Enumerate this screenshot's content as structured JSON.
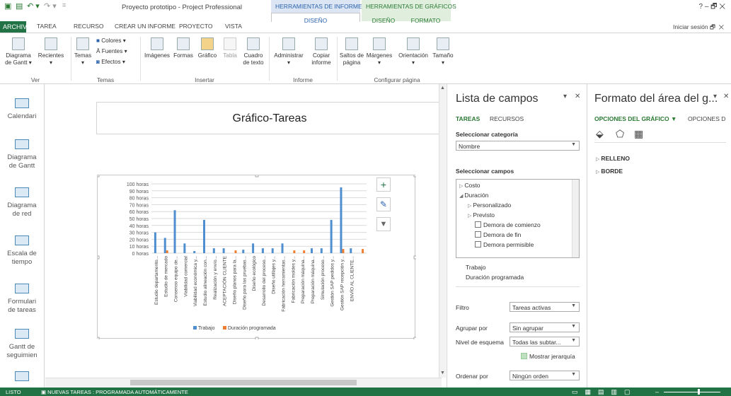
{
  "window": {
    "title": "Proyecto prototipo - Project Professional",
    "controls": "?  –  🗗  ✕"
  },
  "contextual": {
    "reports": {
      "header": "HERRAMIENTAS DE INFORMES",
      "tab": "DISEÑO"
    },
    "charts": {
      "header": "HERRAMIENTAS DE GRÁFICOS",
      "tab1": "DISEÑO",
      "tab2": "FORMATO"
    }
  },
  "tabs": {
    "archivo": "ARCHIVO",
    "tarea": "TAREA",
    "recurso": "RECURSO",
    "crear": "CREAR UN INFORME",
    "proyecto": "PROYECTO",
    "vista": "VISTA"
  },
  "signin": "Iniciar sesión",
  "ribbon": {
    "gantt": "Diagrama\nde Gantt ▾",
    "recientes": "Recientes\n▾",
    "temas": "Temas\n▾",
    "colores": "Colores ▾",
    "fuentes": "Fuentes ▾",
    "efectos": "Efectos ▾",
    "imagenes": "Imágenes",
    "formas": "Formas",
    "grafico": "Gráfico",
    "tabla": "Tabla",
    "cuadro": "Cuadro\nde texto",
    "administrar": "Administrar\n▾",
    "copiar": "Copiar\ninforme",
    "saltos": "Saltos de\npágina",
    "margenes": "Márgenes\n▾",
    "orientacion": "Orientación\n▾",
    "tamano": "Tamaño\n▾",
    "groups": {
      "ver": "Ver",
      "temas": "Temas",
      "insertar": "Insertar",
      "informe": "Informe",
      "configurar": "Configurar página"
    }
  },
  "nav": [
    "Calendari",
    "Diagrama\nde Gantt",
    "Diagrama\nde red",
    "Escala de\ntiempo",
    "Formulari\nde tareas",
    "Gantt de\nseguimien"
  ],
  "chart_data": {
    "type": "bar",
    "title": "Gráfico-Tareas",
    "categories": [
      "Estudio departamento...",
      "Estudio de mercado",
      "Consenso equipo de...",
      "Viabilidad comercial",
      "Viabilidad económica y...",
      "Estudio alineación con...",
      "Realización y envío...",
      "ACEPTACIÓN CLIENTE",
      "Diseño planos para la...",
      "Diseño para las pruebas...",
      "Diseño ecológico",
      "Desarrollo del proceso...",
      "Diseño utillajes y...",
      "Fabricación herramientas...",
      "Fabricación moldes y...",
      "Preparación máquina...",
      "Preparación máquina...",
      "Simulación proceso...",
      "Gestión SAP pedidos y...",
      "Gestión SAP recepción y...",
      "ENVÍO AL CLIENTE..."
    ],
    "series": [
      {
        "name": "Trabajo",
        "color": "#4f8fd0",
        "values": [
          30,
          22,
          62,
          14,
          3,
          48,
          7,
          7,
          0,
          5,
          14,
          7,
          7,
          14,
          0,
          0,
          7,
          7,
          48,
          95,
          7,
          0
        ]
      },
      {
        "name": "Duración programada",
        "color": "#ee7d31",
        "values": [
          0,
          4,
          0,
          0,
          0,
          0,
          0,
          0,
          4,
          0,
          0,
          0,
          0,
          0,
          4,
          4,
          0,
          0,
          0,
          6,
          0,
          6
        ]
      }
    ],
    "y_ticks": [
      "100 horas",
      "90 horas",
      "80 horas",
      "70 horas",
      "60 horas",
      "50 horas",
      "40 horas",
      "30 horas",
      "20 horas",
      "10 horas",
      "0 horas"
    ],
    "ylim": [
      0,
      100
    ],
    "legend_position": "bottom"
  },
  "fieldpane": {
    "title": "Lista de campos",
    "tab_tareas": "TAREAS",
    "tab_recursos": "RECURSOS",
    "cat_label": "Seleccionar categoría",
    "cat_value": "Nombre",
    "fields_label": "Seleccionar campos",
    "fields": [
      {
        "label": "Costo",
        "kind": "collapsed"
      },
      {
        "label": "Duración",
        "kind": "expanded"
      },
      {
        "label": "Personalizado",
        "kind": "collapsed-sub"
      },
      {
        "label": "Previsto",
        "kind": "collapsed-sub"
      },
      {
        "label": "Demora de comienzo",
        "kind": "check"
      },
      {
        "label": "Demora de fin",
        "kind": "check"
      },
      {
        "label": "Demora permisible",
        "kind": "check"
      }
    ],
    "selected": [
      "Trabajo",
      "Duración programada"
    ],
    "filtro_label": "Filtro",
    "filtro_value": "Tareas activas",
    "agrupar_label": "Agrupar por",
    "agrupar_value": "Sin agrupar",
    "nivel_label": "Nivel de esquema",
    "nivel_value": "Todas las subtar...",
    "jerarquia_label": "Mostrar jerarquía",
    "ordenar_label": "Ordenar por",
    "ordenar_value": "Ningún orden"
  },
  "formatpane": {
    "title": "Formato del área del g...",
    "opt1": "OPCIONES DEL GRÁFICO ▼",
    "opt2": "OPCIONES D",
    "relleno": "RELLENO",
    "borde": "BORDE"
  },
  "status": {
    "listo": "LISTO",
    "tareas": "NUEVAS TAREAS : PROGRAMADA AUTOMÁTICAMENTE"
  }
}
